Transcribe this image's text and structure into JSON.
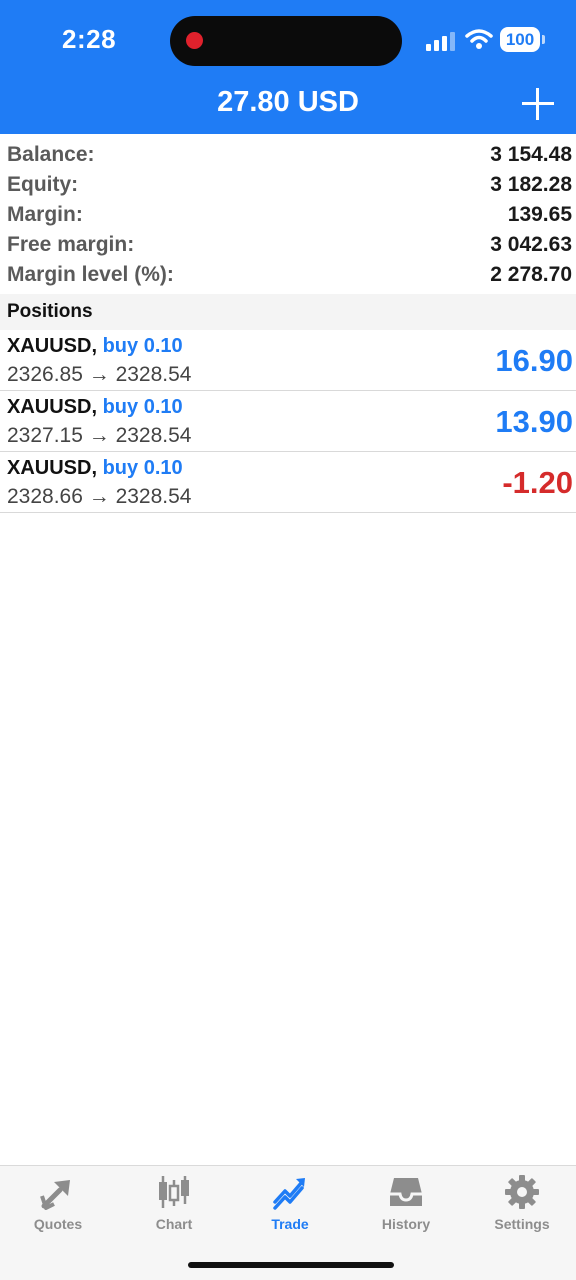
{
  "status_bar": {
    "time": "2:28",
    "battery": "100"
  },
  "header": {
    "title": "27.80 USD",
    "add_icon": "plus-icon"
  },
  "account": {
    "rows": [
      {
        "label": "Balance:",
        "value": "3 154.48"
      },
      {
        "label": "Equity:",
        "value": "3 182.28"
      },
      {
        "label": "Margin:",
        "value": "139.65"
      },
      {
        "label": "Free margin:",
        "value": "3 042.63"
      },
      {
        "label": "Margin level (%):",
        "value": "2 278.70"
      }
    ]
  },
  "positions": {
    "header": "Positions",
    "items": [
      {
        "symbol": "XAUUSD,",
        "side": "buy 0.10",
        "prices": "2326.85 → 2328.54",
        "profit": "16.90",
        "profit_color": "#1f7cf5"
      },
      {
        "symbol": "XAUUSD,",
        "side": "buy 0.10",
        "prices": "2327.15 → 2328.54",
        "profit": "13.90",
        "profit_color": "#1f7cf5"
      },
      {
        "symbol": "XAUUSD,",
        "side": "buy 0.10",
        "prices": "2328.66 → 2328.54",
        "profit": "-1.20",
        "profit_color": "#d52b2b"
      }
    ]
  },
  "tabbar": {
    "tabs": [
      {
        "label": "Quotes",
        "icon": "quotes-icon"
      },
      {
        "label": "Chart",
        "icon": "candlestick-icon"
      },
      {
        "label": "Trade",
        "icon": "trade-icon",
        "active": true
      },
      {
        "label": "History",
        "icon": "inbox-icon"
      },
      {
        "label": "Settings",
        "icon": "gear-icon"
      }
    ]
  },
  "colors": {
    "accent": "#1f7cf5",
    "negative": "#d52b2b"
  }
}
